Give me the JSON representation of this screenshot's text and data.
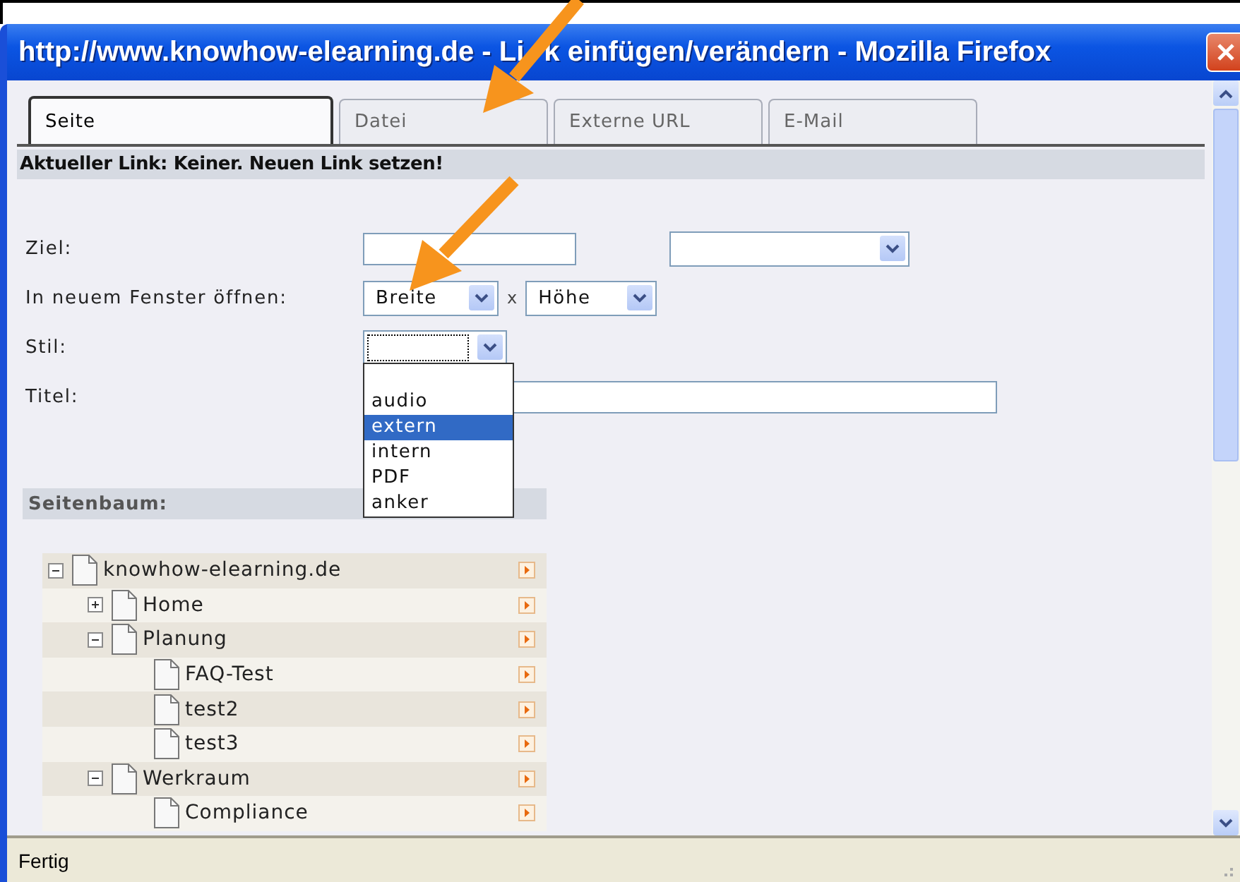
{
  "window": {
    "title": "http://www.knowhow-elearning.de - Li",
    "title_continued": "k einfügen/verändern - Mozilla Firefox"
  },
  "tabs": [
    {
      "label": "Seite",
      "selected": true
    },
    {
      "label": "Datei",
      "selected": false
    },
    {
      "label": "Externe URL",
      "selected": false
    },
    {
      "label": "E-Mail",
      "selected": false
    }
  ],
  "current_link": "Aktueller Link: Keiner. Neuen Link setzen!",
  "form": {
    "target_label": "Ziel:",
    "new_window_label": "In neuem Fenster öffnen:",
    "width_select": "Breite",
    "times": "x",
    "height_select": "Höhe",
    "style_label": "Stil:",
    "title_label": "Titel:"
  },
  "style_options": [
    {
      "label": "audio",
      "selected": false
    },
    {
      "label": "extern",
      "selected": true
    },
    {
      "label": "intern",
      "selected": false
    },
    {
      "label": "PDF",
      "selected": false
    },
    {
      "label": "anker",
      "selected": false
    }
  ],
  "page_tree": {
    "heading": "Seitenbaum:",
    "items": [
      {
        "label": "knowhow-elearning.de",
        "expanded": true,
        "children": [
          {
            "label": "Home",
            "expanded": false
          },
          {
            "label": "Planung",
            "expanded": true,
            "children": [
              {
                "label": "FAQ-Test"
              },
              {
                "label": "test2"
              },
              {
                "label": "test3"
              }
            ]
          },
          {
            "label": "Werkraum",
            "expanded": true,
            "children": [
              {
                "label": "Compliance"
              }
            ]
          }
        ]
      }
    ]
  },
  "status_bar": "Fertig"
}
